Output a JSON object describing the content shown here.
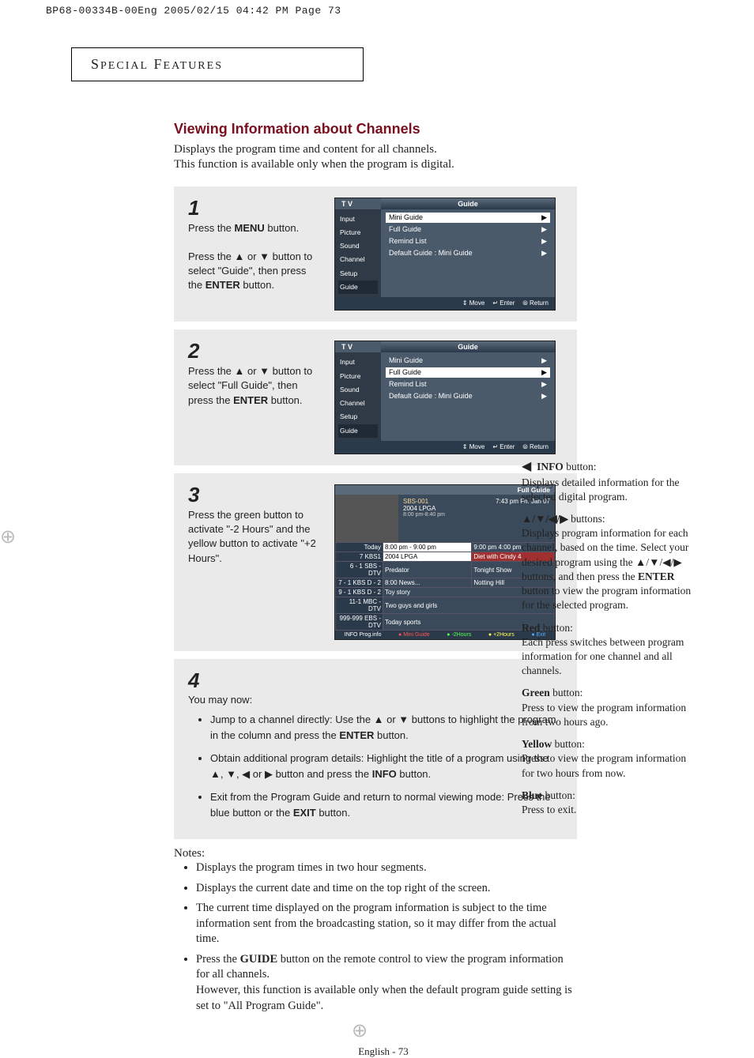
{
  "crop_header": "BP68-00334B-00Eng  2005/02/15  04:42 PM  Page 73",
  "section_title": "SPECIAL FEATURES",
  "main_title": "Viewing Information about Channels",
  "intro_line1": "Displays the program time and content for all channels.",
  "intro_line2": "This function is available only when the program is digital.",
  "steps": {
    "s1": {
      "num": "1",
      "p1_a": "Press the ",
      "p1_b": "MENU",
      "p1_c": " button.",
      "p2_a": "Press the ▲ or ▼ button to select \"Guide\", then press the ",
      "p2_b": "ENTER",
      "p2_c": " button."
    },
    "s2": {
      "num": "2",
      "p1_a": "Press the ▲ or ▼ button to select \"Full Guide\", then press the ",
      "p1_b": "ENTER",
      "p1_c": " button."
    },
    "s3": {
      "num": "3",
      "p1": "Press the green button to activate \"-2 Hours\" and the yellow button to activate \"+2 Hours\"."
    },
    "s4": {
      "num": "4",
      "lead": "You may now:",
      "b1_a": "Jump to a channel directly: Use the ▲ or ▼ buttons to highlight the program in the column and press the ",
      "b1_b": "ENTER",
      "b1_c": " button.",
      "b2_a": "Obtain additional program details: Highlight the title of a program using the ▲, ▼, ◀ or ▶ button and press the ",
      "b2_b": "INFO",
      "b2_c": " button.",
      "b3_a": "Exit from the Program Guide and return to normal viewing mode: Press the blue button or the ",
      "b3_b": "EXIT",
      "b3_c": " button."
    }
  },
  "osd": {
    "tv": "T V",
    "header_title": "Guide",
    "side": [
      "Input",
      "Picture",
      "Sound",
      "Channel",
      "Setup",
      "Guide"
    ],
    "rows": [
      {
        "label": "Mini Guide",
        "arrow": "▶"
      },
      {
        "label": "Full Guide",
        "arrow": "▶"
      },
      {
        "label": "Remind List",
        "arrow": "▶"
      },
      {
        "label": "Default Guide",
        "value": ":   Mini Guide",
        "arrow": "▶"
      }
    ],
    "footer": [
      "⇕ Move",
      "↵ Enter",
      "⦾ Return"
    ]
  },
  "fullguide": {
    "title": "Full Guide",
    "info_ch": "SBS-001",
    "info_prog": "2004 LPGA",
    "info_time": "8:00 pm-8:40 pm",
    "info_clock": "7:43 pm  Fri. Jan 07",
    "cols": [
      "Today",
      "8:00 pm - 9:00 pm",
      "9:00 pm    4:00 pm"
    ],
    "rows": [
      {
        "ch": "7            KBS1",
        "c1": "2004 LPGA",
        "c2": "Diet with Cindy 4"
      },
      {
        "ch": "6 - 1   SBS - DTV",
        "c1": "Predator",
        "c2": "Tonight Show"
      },
      {
        "ch": "7 - 1   KBS D - 2",
        "c1": "8:00 News...",
        "c12": "Notting Hill"
      },
      {
        "ch": "9 - 1   KBS D - 2",
        "c1": "Toy story"
      },
      {
        "ch": "11-1   MBC - DTV",
        "c1": "Two guys and girls"
      },
      {
        "ch": "999-999 EBS - DTV",
        "c1": "Today sports"
      }
    ],
    "footer": [
      "INFO Prog.info",
      "● Mini Guide",
      "● -2Hours",
      "● +2Hours",
      "● Exit"
    ]
  },
  "notes_title": "Notes:",
  "notes": [
    "Displays the program times in two hour segments.",
    "Displays the current date and time on the top right of the screen.",
    "The current time displayed on the program information is subject to the time information sent from the broadcasting station, so it may differ from the actual time.",
    {
      "a": "Press the ",
      "b": "GUIDE",
      "c": " button on the remote control to view the program information for all channels.",
      "d": "However, this function is available only when the default program guide setting is set to \"All Program Guide\"."
    }
  ],
  "sidebar": {
    "arrow": "◀",
    "info_b": "INFO",
    "info_t": " button:",
    "info_d": "Displays detailed information for the selected digital program.",
    "nav_b": "▲/▼/◀/▶",
    "nav_t": "  buttons:",
    "nav_d1": "Displays program information for each channel, based on the time. Select your desired program using the ",
    "nav_d2": "▲/▼/◀/▶",
    "nav_d3": " buttons, and then press the ",
    "nav_d4": "ENTER",
    "nav_d5": " button to view the program information for the selected program.",
    "red_b": "Red",
    "red_t": " button:",
    "red_d": "Each press switches between program information for one channel and all channels.",
    "green_b": "Green",
    "green_t": " button:",
    "green_d": "Press to view the program information from two hours ago.",
    "yellow_b": "Yellow",
    "yellow_t": " button:",
    "yellow_d": " Press to view the program information for two hours from now.",
    "blue_b": "Blue",
    "blue_t": " button:",
    "blue_d": "Press to exit."
  },
  "page_num": "English - 73"
}
